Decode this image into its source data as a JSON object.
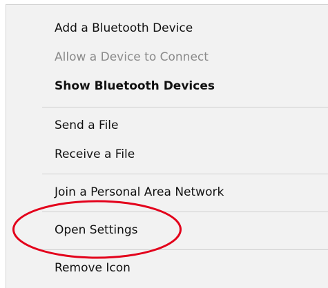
{
  "context_menu": {
    "items": [
      {
        "label": "Add a Bluetooth Device",
        "state": "enabled"
      },
      {
        "label": "Allow a Device to Connect",
        "state": "disabled"
      },
      {
        "label": "Show Bluetooth Devices",
        "state": "default"
      },
      {
        "label": "Send a File",
        "state": "enabled"
      },
      {
        "label": "Receive a File",
        "state": "enabled"
      },
      {
        "label": "Join a Personal Area Network",
        "state": "enabled"
      },
      {
        "label": "Open Settings",
        "state": "enabled",
        "annotated": true
      },
      {
        "label": "Remove Icon",
        "state": "enabled"
      }
    ]
  },
  "annotation": {
    "shape": "ellipse",
    "color": "#e3001b",
    "target": "Open Settings"
  }
}
